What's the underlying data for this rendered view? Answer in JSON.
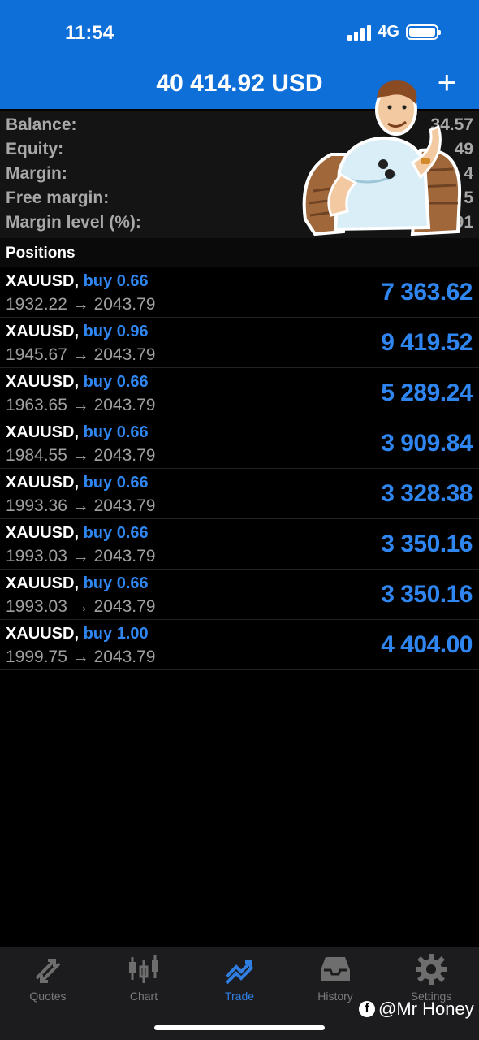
{
  "status": {
    "time": "11:54",
    "network": "4G"
  },
  "header": {
    "title": "40 414.92 USD",
    "add_label": "+"
  },
  "summary": [
    {
      "label": "Balance:",
      "value": "34.57"
    },
    {
      "label": "Equity:",
      "value": "49"
    },
    {
      "label": "Margin:",
      "value": "4"
    },
    {
      "label": "Free margin:",
      "value": "5"
    },
    {
      "label": "Margin level (%):",
      "value": "91"
    }
  ],
  "positions": {
    "title": "Positions",
    "items": [
      {
        "symbol": "XAUUSD,",
        "side": "buy 0.66",
        "prices": "1932.22 → 2043.79",
        "profit": "7 363.62"
      },
      {
        "symbol": "XAUUSD,",
        "side": "buy 0.96",
        "prices": "1945.67 → 2043.79",
        "profit": "9 419.52"
      },
      {
        "symbol": "XAUUSD,",
        "side": "buy 0.66",
        "prices": "1963.65 → 2043.79",
        "profit": "5 289.24"
      },
      {
        "symbol": "XAUUSD,",
        "side": "buy 0.66",
        "prices": "1984.55 → 2043.79",
        "profit": "3 909.84"
      },
      {
        "symbol": "XAUUSD,",
        "side": "buy 0.66",
        "prices": "1993.36 → 2043.79",
        "profit": "3 328.38"
      },
      {
        "symbol": "XAUUSD,",
        "side": "buy 0.66",
        "prices": "1993.03 → 2043.79",
        "profit": "3 350.16"
      },
      {
        "symbol": "XAUUSD,",
        "side": "buy 0.66",
        "prices": "1993.03 → 2043.79",
        "profit": "3 350.16"
      },
      {
        "symbol": "XAUUSD,",
        "side": "buy 1.00",
        "prices": "1999.75 → 2043.79",
        "profit": "4 404.00"
      }
    ]
  },
  "tabs": [
    {
      "label": "Quotes",
      "icon": "quotes-icon",
      "active": false
    },
    {
      "label": "Chart",
      "icon": "chart-icon",
      "active": false
    },
    {
      "label": "Trade",
      "icon": "trade-icon",
      "active": true
    },
    {
      "label": "History",
      "icon": "history-icon",
      "active": false
    },
    {
      "label": "Settings",
      "icon": "settings-icon",
      "active": false
    }
  ],
  "watermark": {
    "text": "@Mr Honey",
    "icon": "facebook-icon"
  },
  "colors": {
    "header_bg": "#0f6fd9",
    "accent_blue": "#2f86f0",
    "tab_active": "#2f7ee0"
  }
}
